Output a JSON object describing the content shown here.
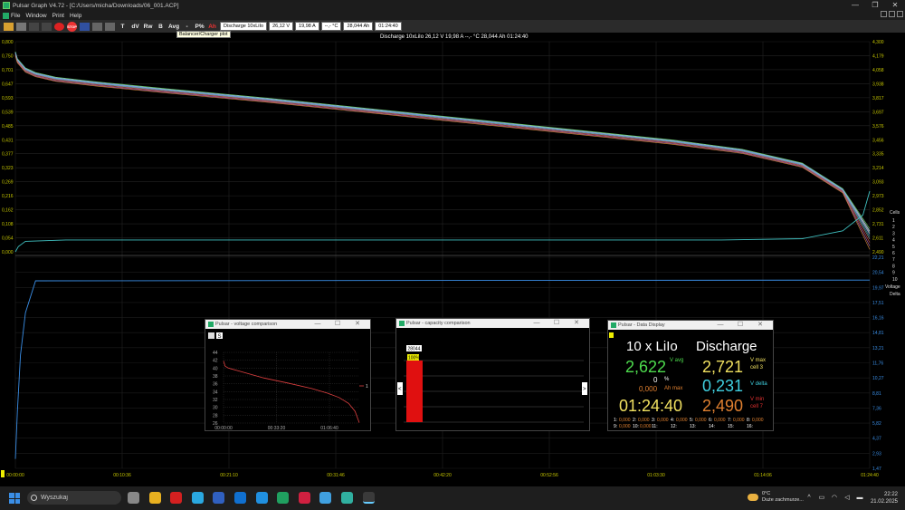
{
  "window": {
    "title": "Pulsar Graph V4.72 - [C:/Users/micha/Downloads/06_001.ACP]"
  },
  "menu": [
    "File",
    "Window",
    "Print",
    "Help"
  ],
  "toolbar": {
    "btn_t": "T",
    "btn_dv": "dV",
    "btn_rw": "Rw",
    "btn_b": "B",
    "btn_avg": "Avg",
    "btn_dash": "-",
    "btn_p": "P%",
    "btn_ah": "Ah",
    "stop_label": "STOP",
    "fields": [
      "Discharge 10xLiIo",
      "26,12 V",
      "19,98 A",
      "--,- °C",
      "28,044 Ah",
      "01:24:40"
    ],
    "tooltip": "Balancer/Charger plot"
  },
  "main_header": "Discharge 10xLiIo   26,12 V   19,98 A   --,- °C   28,044 Ah   01:24:40",
  "chart_data": {
    "type": "line",
    "x_ticks": [
      "00:00:00",
      "00:10:36",
      "00:21:10",
      "00:31:46",
      "00:42:20",
      "00:52:56",
      "01:03:30",
      "01:14:06",
      "01:24:40"
    ],
    "left_ticks": [
      "0,800",
      "0,750",
      "0,701",
      "0,647",
      "0,593",
      "0,539",
      "0,485",
      "0,431",
      "0,377",
      "0,323",
      "0,269",
      "0,216",
      "0,162",
      "0,108",
      "0,054",
      "0,000"
    ],
    "right_ticks_top": [
      "4,300",
      "4,179",
      "4,058",
      "3,938",
      "3,817",
      "3,697",
      "3,576",
      "3,456",
      "3,335",
      "3,214",
      "3,093",
      "2,973",
      "2,852",
      "2,731",
      "2,611",
      "2,490"
    ],
    "right_ticks_bottom": [
      "22,21",
      "20,54",
      "19,97",
      "17,51",
      "16,16",
      "14,81",
      "13,21",
      "11,76",
      "10,27",
      "8,81",
      "7,36",
      "5,82",
      "4,37",
      "2,93",
      "1,47"
    ],
    "legend_title": "Cells",
    "legend": [
      "1",
      "2",
      "3",
      "4",
      "5",
      "6",
      "7",
      "8",
      "9",
      "10"
    ],
    "legend_extra": [
      "Voltage",
      "Delta"
    ],
    "legend_colors": [
      "#ffffff",
      "#e8e870",
      "#70e070",
      "#40c0c0",
      "#e05050",
      "#c070c0",
      "#e09040",
      "#9090ff",
      "#a0a0a0",
      "#60a0e0"
    ],
    "cell_curve": {
      "x": [
        0,
        0.2,
        1,
        2,
        4,
        8,
        15,
        25,
        35,
        45,
        55,
        65,
        72,
        78,
        82,
        84.67
      ],
      "y": [
        4.2,
        4.14,
        4.06,
        4.02,
        3.98,
        3.94,
        3.88,
        3.8,
        3.71,
        3.62,
        3.53,
        3.44,
        3.36,
        3.24,
        3.02,
        2.62
      ]
    },
    "delta_curve": {
      "x": [
        0,
        0.3,
        1,
        5,
        40,
        70,
        78,
        82,
        84,
        84.67
      ],
      "y": [
        0.0,
        0.02,
        0.04,
        0.045,
        0.045,
        0.045,
        0.05,
        0.08,
        0.14,
        0.231
      ]
    },
    "pack_voltage_curve": {
      "x": [
        0,
        0.2,
        0.5,
        1,
        2,
        84.67
      ],
      "y": [
        1.0,
        6.0,
        12.0,
        16.5,
        19.9,
        19.98
      ]
    }
  },
  "voltage_panel": {
    "title": "Pulsar - voltage comparison",
    "btn_s": "S",
    "y_ticks": [
      "44",
      "42",
      "40",
      "38",
      "36",
      "34",
      "32",
      "30",
      "28",
      "26"
    ],
    "x_ticks": [
      "00:00:00",
      "00:33:20",
      "01:06:40"
    ],
    "series_label": "1",
    "curve": {
      "x": [
        0,
        1,
        3,
        10,
        25,
        40,
        55,
        65,
        72,
        78,
        82,
        84.67
      ],
      "y": [
        41.8,
        40.5,
        40.0,
        39.2,
        37.5,
        36.2,
        34.8,
        33.6,
        32.5,
        31.0,
        29.0,
        26.1
      ]
    }
  },
  "capacity_panel": {
    "title": "Pulsar - capacity comparison",
    "bar_value": "28044",
    "bar_percent": "100%",
    "bar_label": "1",
    "bar_fill": 1.0,
    "left_arrow": "<",
    "right_arrow": ">"
  },
  "data_display": {
    "title": "Pulsar - Data Display",
    "pack": "10 x LiIo",
    "mode": "Discharge",
    "v_avg": "2,622",
    "v_avg_label": "V avg",
    "v_max": "2,721",
    "v_max_label": "V max",
    "v_max_cell": "cell 3",
    "percent": "0",
    "percent_label": "%",
    "ah_max": "0,000",
    "ah_max_label": "Ah max",
    "v_delta": "0,231",
    "v_delta_label": "V delta",
    "time": "01:24:40",
    "v_min": "2,490",
    "v_min_label": "V min",
    "v_min_cell": "cell 7",
    "channels": [
      {
        "n": "1:",
        "v": "0,000"
      },
      {
        "n": "2:",
        "v": "0,000"
      },
      {
        "n": "3:",
        "v": "0,000"
      },
      {
        "n": "4:",
        "v": "0,000"
      },
      {
        "n": "5:",
        "v": "0,000"
      },
      {
        "n": "6:",
        "v": "0,000"
      },
      {
        "n": "7:",
        "v": "0,000"
      },
      {
        "n": "8:",
        "v": "0,000"
      },
      {
        "n": "9:",
        "v": "0,000"
      },
      {
        "n": "10:",
        "v": "0,000"
      },
      {
        "n": "11:",
        "v": ""
      },
      {
        "n": "12:",
        "v": ""
      },
      {
        "n": "13:",
        "v": ""
      },
      {
        "n": "14:",
        "v": ""
      },
      {
        "n": "15:",
        "v": ""
      },
      {
        "n": "16:",
        "v": ""
      }
    ]
  },
  "taskbar": {
    "search_placeholder": "Wyszukaj",
    "weather_temp": "0°C",
    "weather_desc": "Duże zachmurze...",
    "time": "22:22",
    "date": "21.02.2025",
    "apps": [
      "files-app-icon",
      "chrome-icon",
      "opera-icon",
      "edge-icon",
      "store-icon",
      "outlook-icon",
      "photos-icon",
      "excel-icon",
      "snip-icon",
      "paint-icon",
      "maps-icon",
      "pulsar-icon"
    ]
  }
}
